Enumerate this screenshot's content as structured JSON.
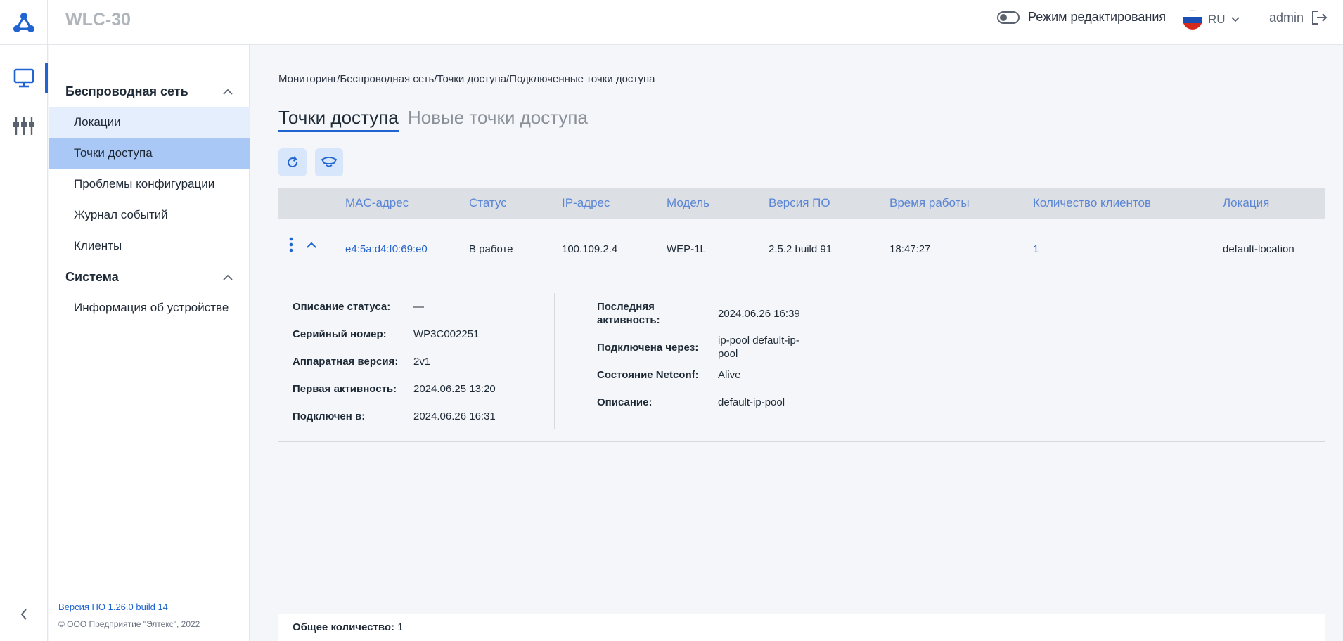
{
  "header": {
    "app_title": "WLC-30",
    "edit_mode_label": "Режим редактирования",
    "language": "RU",
    "username": "admin"
  },
  "icons": {
    "logo": "network-logo-icon",
    "monitoring": "monitor-icon",
    "configuration": "sliders-icon",
    "collapse": "chevron-left-icon",
    "logout": "logout-icon",
    "refresh": "refresh-icon",
    "reboot": "reboot-ap-icon"
  },
  "sidebar": {
    "groups": [
      {
        "title": "Беспроводная сеть",
        "items": [
          "Локации",
          "Точки доступа",
          "Проблемы конфигурации",
          "Журнал событий",
          "Клиенты"
        ]
      },
      {
        "title": "Система",
        "items": [
          "Информация об устройстве"
        ]
      }
    ],
    "firmware_version": "Версия ПО 1.26.0 build 14",
    "copyright": "© ООО Предприятие \"Элтекс\", 2022"
  },
  "breadcrumb": "Мониторинг/Беспроводная сеть/Точки доступа/Подключенные точки доступа",
  "tabs": [
    "Точки доступа",
    "Новые точки доступа"
  ],
  "table": {
    "columns": [
      "MAC-адрес",
      "Статус",
      "IP-адрес",
      "Модель",
      "Версия ПО",
      "Время работы",
      "Количество клиентов",
      "Локация"
    ],
    "rows": [
      {
        "mac": "e4:5a:d4:f0:69:e0",
        "status": "В работе",
        "ip": "100.109.2.4",
        "model": "WEP-1L",
        "firmware": "2.5.2 build 91",
        "uptime": "18:47:27",
        "clients": "1",
        "location": "default-location"
      }
    ]
  },
  "details": {
    "left": [
      {
        "label": "Описание статуса:",
        "value": "—"
      },
      {
        "label": "Серийный номер:",
        "value": "WP3C002251"
      },
      {
        "label": "Аппаратная версия:",
        "value": "2v1"
      },
      {
        "label": "Первая активность:",
        "value": "2024.06.25 13:20"
      },
      {
        "label": "Подключен в:",
        "value": "2024.06.26 16:31"
      }
    ],
    "right": [
      {
        "label": "Последняя активность:",
        "value": "2024.06.26 16:39"
      },
      {
        "label": "Подключена через:",
        "value": "ip-pool default-ip-pool"
      },
      {
        "label": "Состояние Netconf:",
        "value": "Alive"
      },
      {
        "label": "Описание:",
        "value": "default-ip-pool"
      }
    ]
  },
  "footer": {
    "total_label": "Общее количество:",
    "total_value": "1"
  },
  "colors": {
    "accent": "#1f64d0",
    "active_item": "#aac8f6",
    "hover_item": "#e4eefc",
    "table_header": "#dcdfe3"
  }
}
